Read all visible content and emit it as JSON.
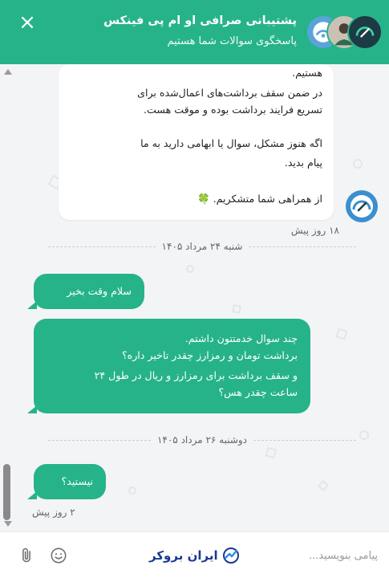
{
  "header": {
    "title": "پشتیبانی صرافی او ام پی فینکس",
    "subtitle": "پاسخگوی سوالات شما هستیم",
    "close_icon": "×",
    "background": "#26b38a"
  },
  "messages": {
    "support_reply": {
      "lines": [
        "هستیم.",
        "در ضمن سقف برداشت‌های اعمال‌شده برای",
        "تسریع فرایند برداشت بوده و موقت هست.",
        "",
        "اگه هنوز مشکل، سوال یا ابهامی دارید به ما",
        "پیام بدید.",
        "",
        "از همراهی شما متشکریم."
      ],
      "emoji": "🍀",
      "timestamp": "۱۸ روز پیش"
    },
    "date_1": "شنبه ۲۴ مرداد ۱۴۰۵",
    "user_greeting": "سلام وقت بخیر",
    "user_question_lines": [
      "چند سوال خدمتتون داشتم.",
      "برداشت تومان و رمزارز چقدر تاخیر داره؟",
      "و سقف برداشت برای رمزارز و ریال در طول ۲۴",
      "ساعت چقدر هس؟"
    ],
    "date_2": "دوشنبه ۲۶ مرداد ۱۴۰۵",
    "user_followup": "نیستید؟",
    "user_followup_timestamp": "۲ روز پیش"
  },
  "composer": {
    "placeholder": "پیامی بنویسید...",
    "brand": "ایران بروکر",
    "attach_icon": "paperclip-icon",
    "emoji_icon": "smiley-icon"
  },
  "colors": {
    "accent": "#26b38a",
    "chat_background": "#f3f4f6",
    "brand_blue": "#1b3a8f"
  }
}
